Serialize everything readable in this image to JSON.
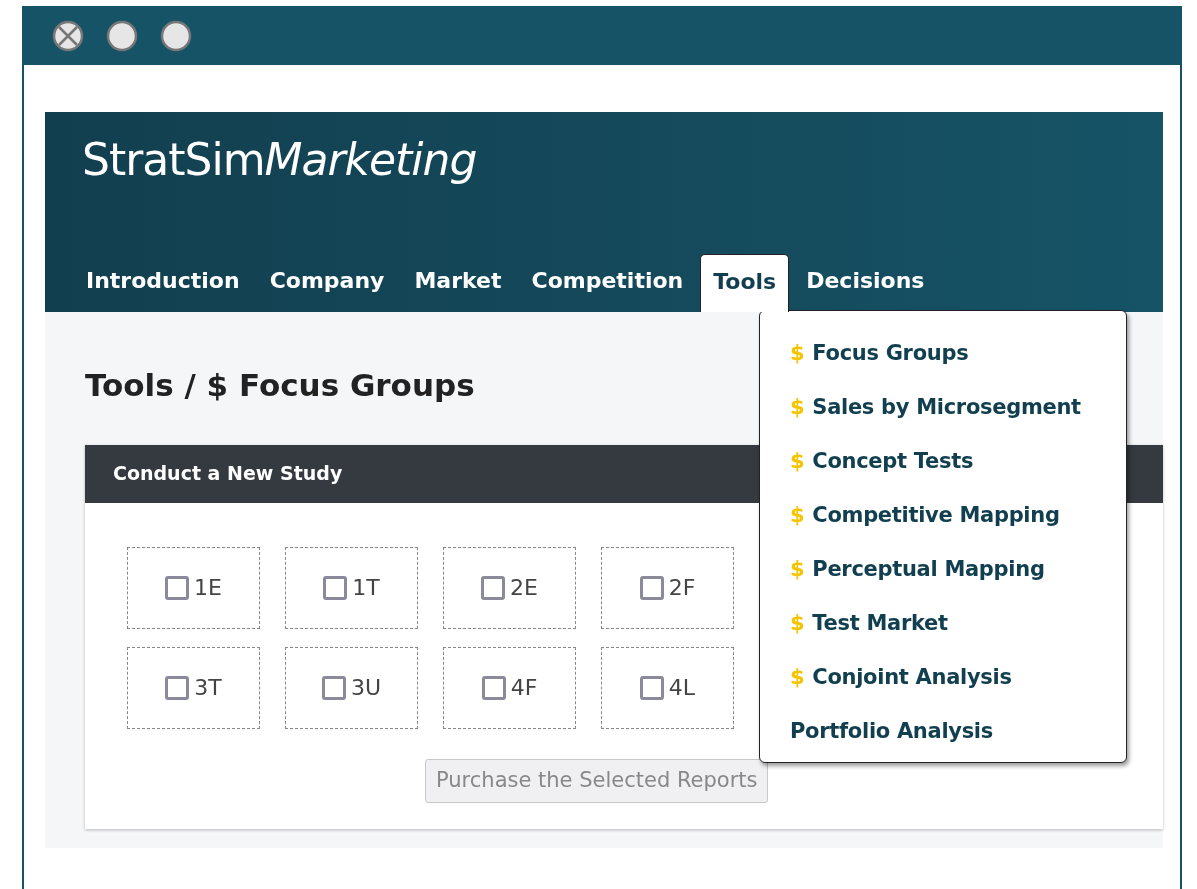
{
  "window": {
    "controls": [
      {
        "kind": "close"
      },
      {
        "kind": "plain"
      },
      {
        "kind": "plain"
      }
    ]
  },
  "app": {
    "brand": "StratSim",
    "brand_italic": "Marketing"
  },
  "nav": [
    {
      "label": "Introduction",
      "selected": false
    },
    {
      "label": "Company",
      "selected": false
    },
    {
      "label": "Market",
      "selected": false
    },
    {
      "label": "Competition",
      "selected": false
    },
    {
      "label": "Tools",
      "selected": true
    },
    {
      "label": "Decisions",
      "selected": false
    }
  ],
  "tools_menu": [
    {
      "price_mark": "$",
      "label": "Focus Groups"
    },
    {
      "price_mark": "$",
      "label": "Sales by Microsegment"
    },
    {
      "price_mark": "$",
      "label": "Concept Tests"
    },
    {
      "price_mark": "$",
      "label": "Competitive Mapping"
    },
    {
      "price_mark": "$",
      "label": "Perceptual Mapping"
    },
    {
      "price_mark": "$",
      "label": "Test Market"
    },
    {
      "price_mark": "$",
      "label": "Conjoint Analysis"
    },
    {
      "label": "Portfolio Analysis"
    }
  ],
  "page_title": "Tools / $ Focus Groups",
  "study": {
    "title": "Conduct a New Study",
    "options": [
      {
        "label": "1E",
        "checked": false
      },
      {
        "label": "1T",
        "checked": false
      },
      {
        "label": "2E",
        "checked": false
      },
      {
        "label": "2F",
        "checked": false
      },
      {
        "label": "3T",
        "checked": false
      },
      {
        "label": "3U",
        "checked": false
      },
      {
        "label": "4F",
        "checked": false
      },
      {
        "label": "4L",
        "checked": false
      }
    ],
    "button": {
      "label": "Purchase the Selected Reports",
      "disabled": true
    }
  }
}
